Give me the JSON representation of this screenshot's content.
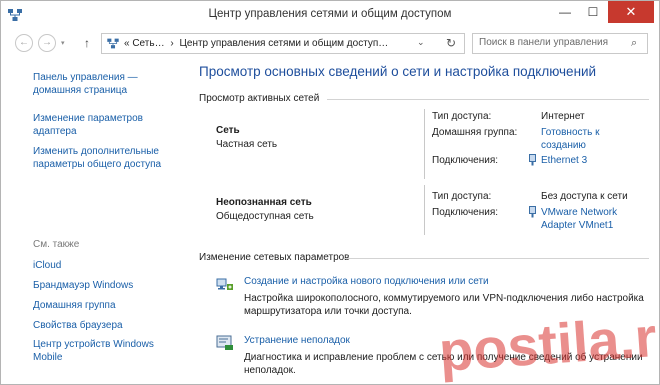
{
  "window": {
    "title": "Центр управления сетями и общим доступом",
    "buttons": {
      "minimize": "—",
      "maximize": "☐",
      "close": "✕"
    }
  },
  "nav": {
    "back_icon": "←",
    "forward_icon": "→",
    "dropdown_icon": "▾",
    "up_icon": "↑",
    "address_prefix": "«  Сеть…",
    "address_sep": "›",
    "address_current": "Центр управления сетями и общим доступ…",
    "address_chevron": "⌄",
    "refresh_icon": "↻",
    "search_placeholder": "Поиск в панели управления",
    "search_icon": "⌕"
  },
  "sidebar": {
    "home_link": "Панель управления — домашняя страница",
    "items": [
      "Изменение параметров адаптера",
      "Изменить дополнительные параметры общего доступа"
    ],
    "see_also_label": "См. также",
    "see_also": [
      "iCloud",
      "Брандмауэр Windows",
      "Домашняя группа",
      "Свойства браузера",
      "Центр устройств Windows Mobile"
    ]
  },
  "main": {
    "title": "Просмотр основных сведений о сети и настройка подключений",
    "active_networks_header": "Просмотр активных сетей",
    "networks": [
      {
        "name": "Сеть",
        "type": "Частная сеть",
        "access_label": "Тип доступа:",
        "access_value": "Интернет",
        "homegroup_label": "Домашняя группа:",
        "homegroup_value": "Готовность к созданию",
        "connections_label": "Подключения:",
        "connection": "Ethernet 3"
      },
      {
        "name": "Неопознанная сеть",
        "type": "Общедоступная сеть",
        "access_label": "Тип доступа:",
        "access_value": "Без доступа к сети",
        "connections_label": "Подключения:",
        "connection": "VMware Network Adapter VMnet1"
      }
    ],
    "change_settings_header": "Изменение сетевых параметров",
    "tasks": [
      {
        "label": "Создание и настройка нового подключения или сети",
        "desc": "Настройка широкополосного, коммутируемого или VPN-подключения либо настройка маршрутизатора или точки доступа."
      },
      {
        "label": "Устранение неполадок",
        "desc": "Диагностика и исправление проблем с сетью или получение сведений об устранении неполадок."
      }
    ]
  },
  "watermark": {
    "text": "postila.ru"
  },
  "colors": {
    "link": "#1a5fa8",
    "title": "#1e4e9c",
    "close": "#c7392e",
    "watermark": "#d9332f"
  }
}
